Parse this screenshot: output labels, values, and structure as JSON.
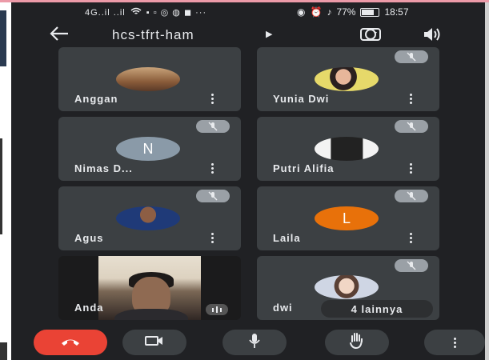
{
  "status_bar": {
    "left": "4G..il  ..il",
    "battery": "77%",
    "time": "18:57"
  },
  "meeting": {
    "title": "hcs-tfrt-ham"
  },
  "participants": [
    {
      "name": "Anggan",
      "muted": false,
      "avatar_type": "photo"
    },
    {
      "name": "Yunia Dwi",
      "muted": true,
      "avatar_type": "photo"
    },
    {
      "name": "Nimas D...",
      "muted": true,
      "avatar_type": "initial",
      "initial": "N",
      "color": "#8a9aa8"
    },
    {
      "name": "Putri Alifia",
      "muted": true,
      "avatar_type": "photo"
    },
    {
      "name": "Agus",
      "muted": true,
      "avatar_type": "photo"
    },
    {
      "name": "Laila",
      "muted": true,
      "avatar_type": "initial",
      "initial": "L",
      "color": "#e8710a"
    },
    {
      "name": "Anda",
      "muted": false,
      "avatar_type": "video"
    },
    {
      "name": "dwi",
      "muted": true,
      "avatar_type": "photo"
    }
  ],
  "others_chip": "4 lainnya",
  "icons": {
    "back": "arrow-left-icon",
    "flip_camera": "flip-camera-icon",
    "speaker": "speaker-icon",
    "more": "more-vert-icon",
    "mic_off": "mic-off-icon",
    "end_call": "end-call-icon",
    "camera": "video-camera-icon",
    "mic": "mic-icon",
    "hand": "raise-hand-icon"
  },
  "colors": {
    "background": "#202124",
    "tile": "#3c4043",
    "end_call": "#ea4335"
  }
}
